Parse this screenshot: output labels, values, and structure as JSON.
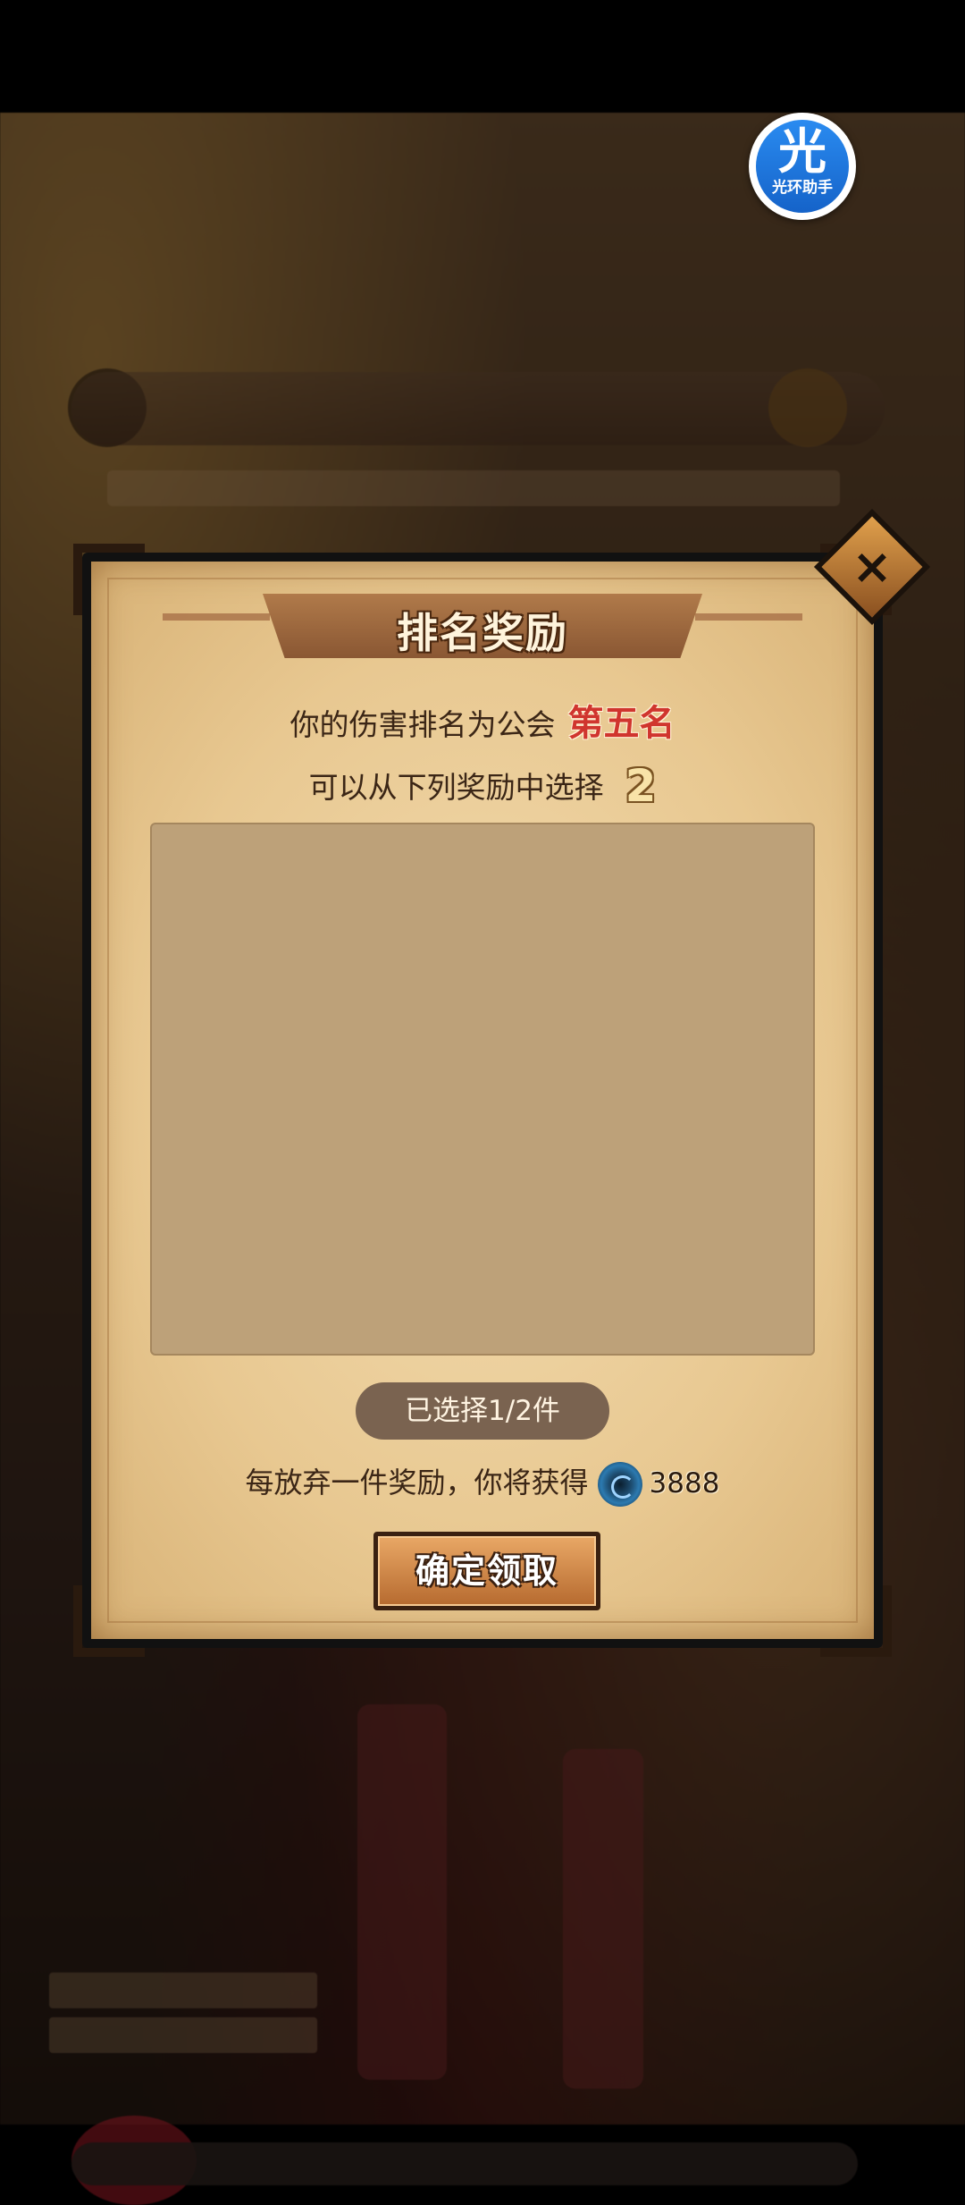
{
  "helper": {
    "glyph": "光",
    "label": "光环助手"
  },
  "dialog": {
    "title": "排名奖励",
    "rank_prefix": "你的伤害排名为公会",
    "rank_value": "第五名",
    "choose_prefix": "可以从下列奖励中选择",
    "choose_count": "2",
    "selected_status": "已选择1/2件",
    "abandon_text": "每放弃一件奖励，你将获得",
    "abandon_reward_amount": "3888",
    "confirm_label": "确定领取",
    "close_label": "×"
  },
  "colors": {
    "rank_highlight": "#d0352e",
    "paper": "#e8c891",
    "button": "#b66a2f"
  }
}
